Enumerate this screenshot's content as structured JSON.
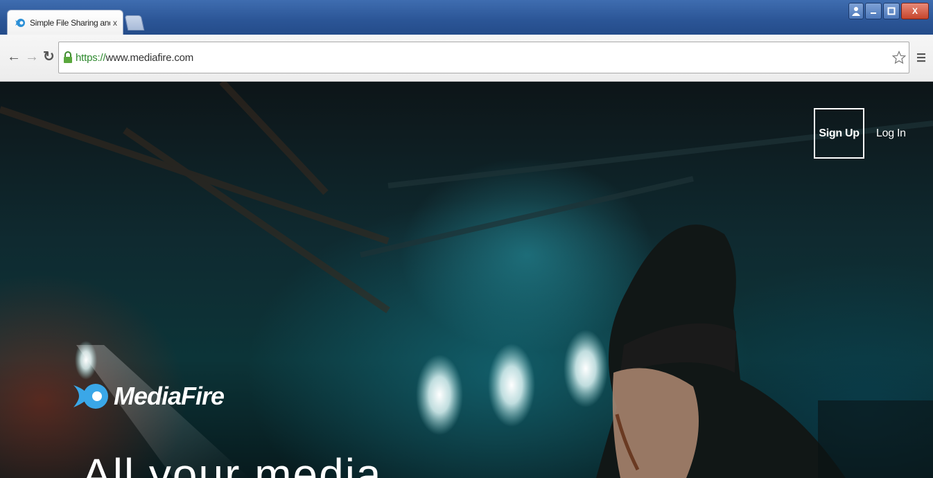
{
  "browser": {
    "tab": {
      "title": "Simple File Sharing and St",
      "close": "x"
    },
    "window_controls": {
      "close": "X"
    },
    "address_bar": {
      "scheme": "https://",
      "host": "www.mediafire.com"
    }
  },
  "site": {
    "nav": {
      "signup": "Sign Up",
      "login": "Log In"
    },
    "brand": {
      "name": "MediaFire"
    },
    "hero": {
      "headline": "All your media"
    }
  },
  "colors": {
    "titlebar": "#2b5596",
    "secure_scheme": "#2f8a2f",
    "brand_blue": "#3aa7e8",
    "hero_teal": "#0f3a3e"
  },
  "icons": [
    "mediafire-favicon",
    "back-arrow-icon",
    "forward-arrow-icon",
    "reload-icon",
    "lock-icon",
    "star-icon",
    "menu-icon",
    "mediafire-logo-icon"
  ]
}
